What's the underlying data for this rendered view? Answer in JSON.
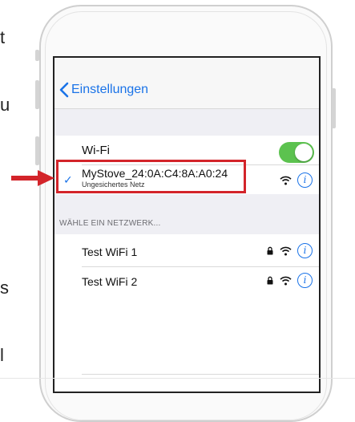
{
  "cut_text": [
    "t",
    "u",
    "s",
    "l"
  ],
  "nav": {
    "back_label": "Einstellungen"
  },
  "wifi": {
    "label": "Wi-Fi",
    "enabled": true
  },
  "connected": {
    "name": "MyStove_24:0A:C4:8A:A0:24",
    "subtitle": "Ungesichertes Netz"
  },
  "section_header": "WÄHLE EIN NETZWERK...",
  "networks": [
    {
      "name": "Test WiFi 1",
      "locked": true
    },
    {
      "name": "Test WiFi 2",
      "locked": true
    }
  ],
  "colors": {
    "accent": "#1a73e8",
    "toggle_on": "#5cc24f",
    "highlight": "#d3242a"
  },
  "icons": {
    "back": "chevron-left-icon",
    "check": "checkmark-icon",
    "wifi": "wifi-icon",
    "lock": "lock-icon",
    "info": "info-icon",
    "arrow": "red-arrow-icon"
  }
}
